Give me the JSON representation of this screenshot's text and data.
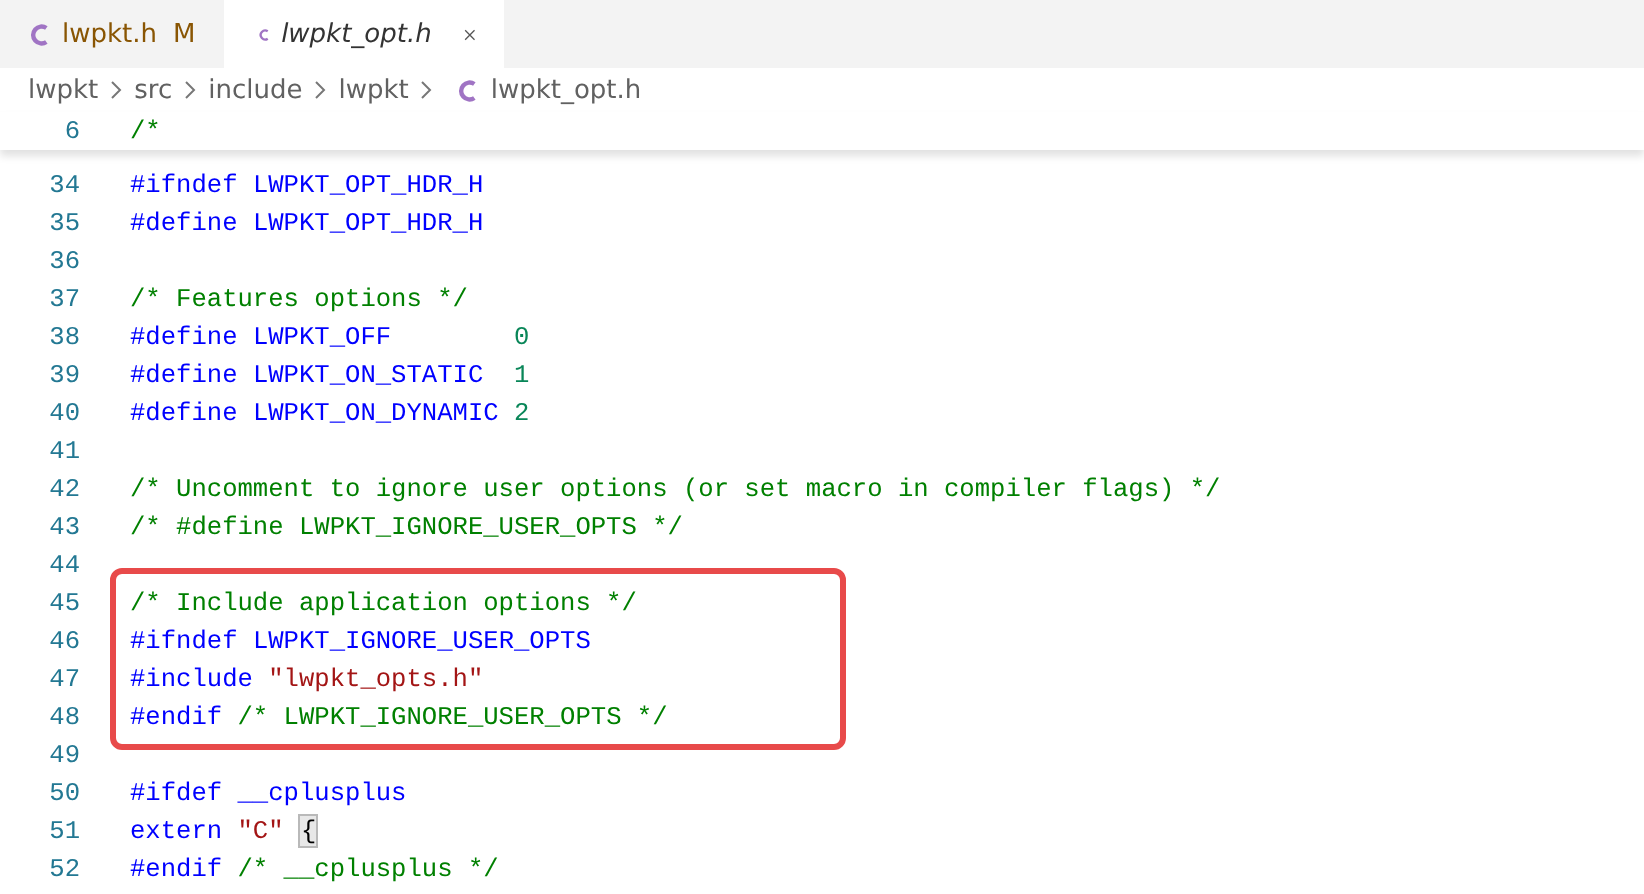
{
  "tabs": [
    {
      "label": "lwpkt.h",
      "badge": "M",
      "modified": true,
      "preview": false,
      "selected": false
    },
    {
      "label": "lwpkt_opt.h",
      "modified": false,
      "preview": true,
      "selected": true
    }
  ],
  "breadcrumbs": [
    {
      "label": "lwpkt",
      "kind": "folder"
    },
    {
      "label": "src",
      "kind": "folder"
    },
    {
      "label": "include",
      "kind": "folder"
    },
    {
      "label": "lwpkt",
      "kind": "folder"
    },
    {
      "label": "lwpkt_opt.h",
      "kind": "file"
    }
  ],
  "sticky_lines": [
    {
      "number": "6",
      "tokens": [
        {
          "kind": "comment",
          "text": "/*"
        }
      ]
    }
  ],
  "lines": [
    {
      "number": "34",
      "tokens": [
        {
          "kind": "directive",
          "text": "#ifndef"
        },
        {
          "kind": "macro",
          "text": " LWPKT_OPT_HDR_H"
        }
      ]
    },
    {
      "number": "35",
      "tokens": [
        {
          "kind": "directive",
          "text": "#define"
        },
        {
          "kind": "macro",
          "text": " LWPKT_OPT_HDR_H"
        }
      ]
    },
    {
      "number": "36"
    },
    {
      "number": "37",
      "tokens": [
        {
          "kind": "comment",
          "text": "/* Features options */"
        }
      ]
    },
    {
      "number": "38",
      "tokens": [
        {
          "kind": "directive",
          "text": "#define"
        },
        {
          "kind": "macro",
          "text": " LWPKT_OFF        "
        },
        {
          "kind": "number",
          "text": "0"
        }
      ]
    },
    {
      "number": "39",
      "tokens": [
        {
          "kind": "directive",
          "text": "#define"
        },
        {
          "kind": "macro",
          "text": " LWPKT_ON_STATIC  "
        },
        {
          "kind": "number",
          "text": "1"
        }
      ]
    },
    {
      "number": "40",
      "tokens": [
        {
          "kind": "directive",
          "text": "#define"
        },
        {
          "kind": "macro",
          "text": " LWPKT_ON_DYNAMIC "
        },
        {
          "kind": "number",
          "text": "2"
        }
      ]
    },
    {
      "number": "41"
    },
    {
      "number": "42",
      "tokens": [
        {
          "kind": "comment",
          "text": "/* Uncomment to ignore user options (or set macro in compiler flags) */"
        }
      ]
    },
    {
      "number": "43",
      "tokens": [
        {
          "kind": "comment",
          "text": "/* #define LWPKT_IGNORE_USER_OPTS */"
        }
      ]
    },
    {
      "number": "44"
    },
    {
      "number": "45",
      "highlighted": true,
      "tokens": [
        {
          "kind": "comment",
          "text": "/* Include application options */"
        }
      ]
    },
    {
      "number": "46",
      "highlighted": true,
      "tokens": [
        {
          "kind": "directive",
          "text": "#ifndef"
        },
        {
          "kind": "macro",
          "text": " LWPKT_IGNORE_USER_OPTS"
        }
      ]
    },
    {
      "number": "47",
      "highlighted": true,
      "tokens": [
        {
          "kind": "directive",
          "text": "#include"
        },
        {
          "kind": "string",
          "text": " \"lwpkt_opts.h\""
        }
      ]
    },
    {
      "number": "48",
      "highlighted": true,
      "tokens": [
        {
          "kind": "directive",
          "text": "#endif"
        },
        {
          "kind": "comment",
          "text": " /* LWPKT_IGNORE_USER_OPTS */"
        }
      ]
    },
    {
      "number": "49"
    },
    {
      "number": "50",
      "tokens": [
        {
          "kind": "directive",
          "text": "#ifdef"
        },
        {
          "kind": "macro",
          "text": " __cplusplus"
        }
      ]
    },
    {
      "number": "51",
      "tokens": [
        {
          "kind": "keyword",
          "text": "extern"
        },
        {
          "kind": "string",
          "text": " \"C\" "
        },
        {
          "kind": "bracket",
          "text": "{"
        }
      ]
    },
    {
      "number": "52",
      "tokens": [
        {
          "kind": "directive",
          "text": "#endif"
        },
        {
          "kind": "comment",
          "text": " /* __cplusplus */"
        }
      ]
    }
  ]
}
